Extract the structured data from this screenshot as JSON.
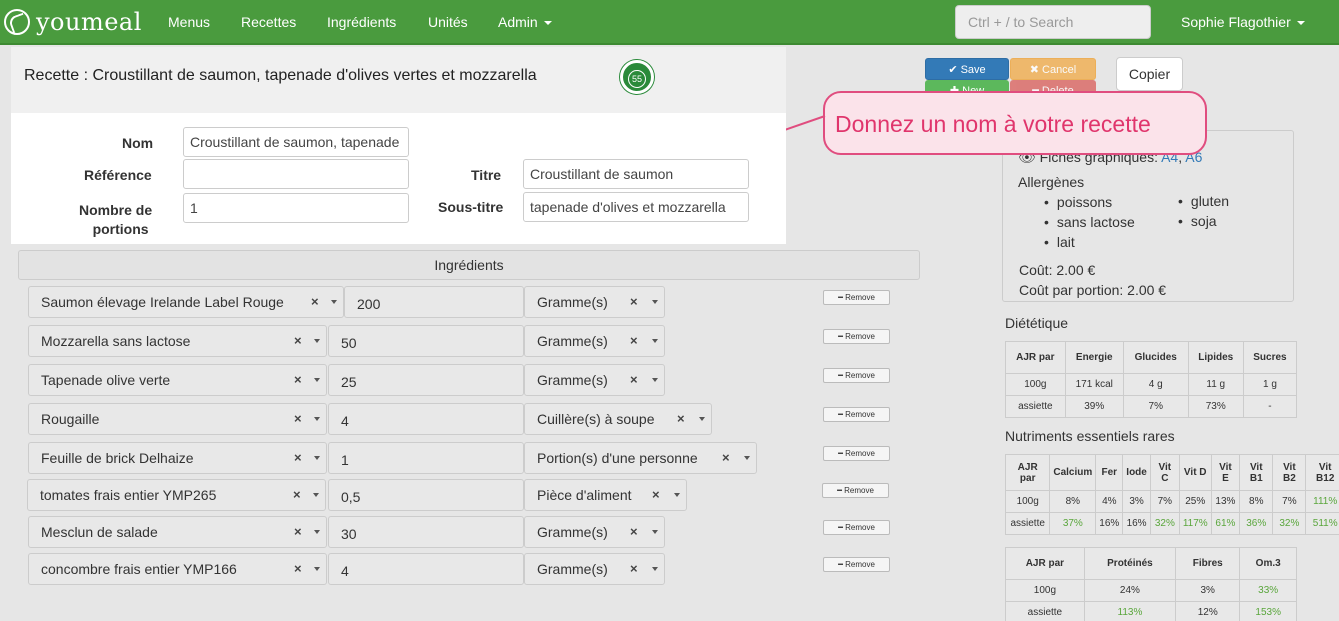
{
  "nav": {
    "brand": "youmeal",
    "items": [
      "Menus",
      "Recettes",
      "Ingrédients",
      "Unités",
      "Admin"
    ],
    "search_placeholder": "Ctrl + / to Search",
    "user": "Sophie Flagothier"
  },
  "recipe": {
    "title": "Recette : Croustillant de saumon, tapenade d'olives vertes et mozzarella",
    "score": "55",
    "labels": {
      "nom": "Nom",
      "reference": "Référence",
      "portions_1": "Nombre de",
      "portions_2": "portions",
      "titre": "Titre",
      "sous_titre": "Sous-titre"
    },
    "values": {
      "nom": "Croustillant de saumon, tapenade",
      "reference": "",
      "portions": "1",
      "titre": "Croustillant de saumon",
      "sous_titre": "tapenade d'olives et mozzarella"
    }
  },
  "actions": {
    "save": "✔ Save",
    "cancel": "✖ Cancel",
    "new": "✚ New",
    "delete": "━ Delete",
    "copy": "Copier"
  },
  "callout": "Donnez un nom à votre recette",
  "info": {
    "fiches_label": "Fiches graphiques:",
    "fiches_a4": "A4",
    "fiches_a6": "A6",
    "allergens_title": "Allergènes",
    "allergens_col1": [
      "poissons",
      "sans lactose",
      "lait"
    ],
    "allergens_col2": [
      "gluten",
      "soja"
    ],
    "cout": "Coût: 2.00 €",
    "cout_portion": "Coût par portion: 2.00 €"
  },
  "ingredients": {
    "header": "Ingrédients",
    "remove_label": "━ Remove",
    "rows": [
      {
        "name": "Saumon élevage Irelande Label Rouge",
        "qty": "200",
        "unit": "Gramme(s)"
      },
      {
        "name": "Mozzarella sans lactose",
        "qty": "50",
        "unit": "Gramme(s)"
      },
      {
        "name": "Tapenade olive verte",
        "qty": "25",
        "unit": "Gramme(s)"
      },
      {
        "name": "Rougaille",
        "qty": "4",
        "unit": "Cuillère(s) à soupe"
      },
      {
        "name": "Feuille de brick Delhaize",
        "qty": "1",
        "unit": "Portion(s) d'une personne"
      },
      {
        "name": "tomates frais entier YMP265",
        "qty": "0,5",
        "unit": "Pièce d'aliment"
      },
      {
        "name": "Mesclun de salade",
        "qty": "30",
        "unit": "Gramme(s)"
      },
      {
        "name": "concombre frais entier YMP166",
        "qty": "4",
        "unit": "Gramme(s)"
      }
    ]
  },
  "dietetique": {
    "title": "Diététique",
    "headers": [
      "AJR par",
      "Energie",
      "Glucides",
      "Lipides",
      "Sucres"
    ],
    "rows": [
      [
        "100g",
        "171 kcal",
        "4 g",
        "11 g",
        "1 g"
      ],
      [
        "assiette",
        "39%",
        "7%",
        "73%",
        "-"
      ]
    ]
  },
  "nutriments": {
    "title": "Nutriments essentiels rares",
    "headers": [
      "AJR par",
      "Calcium",
      "Fer",
      "Iode",
      "Vit C",
      "Vit D",
      "Vit E",
      "Vit B1",
      "Vit B2",
      "Vit B12"
    ],
    "rows": [
      [
        "100g",
        "8%",
        "4%",
        "3%",
        "7%",
        "25%",
        "13%",
        "8%",
        "7%",
        "111%"
      ],
      [
        "assiette",
        "37%",
        "16%",
        "16%",
        "32%",
        "117%",
        "61%",
        "36%",
        "32%",
        "511%"
      ]
    ],
    "green_row1": [
      9
    ],
    "green_row2": [
      1,
      4,
      5,
      6,
      7,
      8,
      9
    ]
  },
  "proteines": {
    "headers": [
      "AJR par",
      "Protéinés",
      "Fibres",
      "Om.3"
    ],
    "rows": [
      [
        "100g",
        "24%",
        "3%",
        "33%"
      ],
      [
        "assiette",
        "113%",
        "12%",
        "153%"
      ]
    ]
  }
}
